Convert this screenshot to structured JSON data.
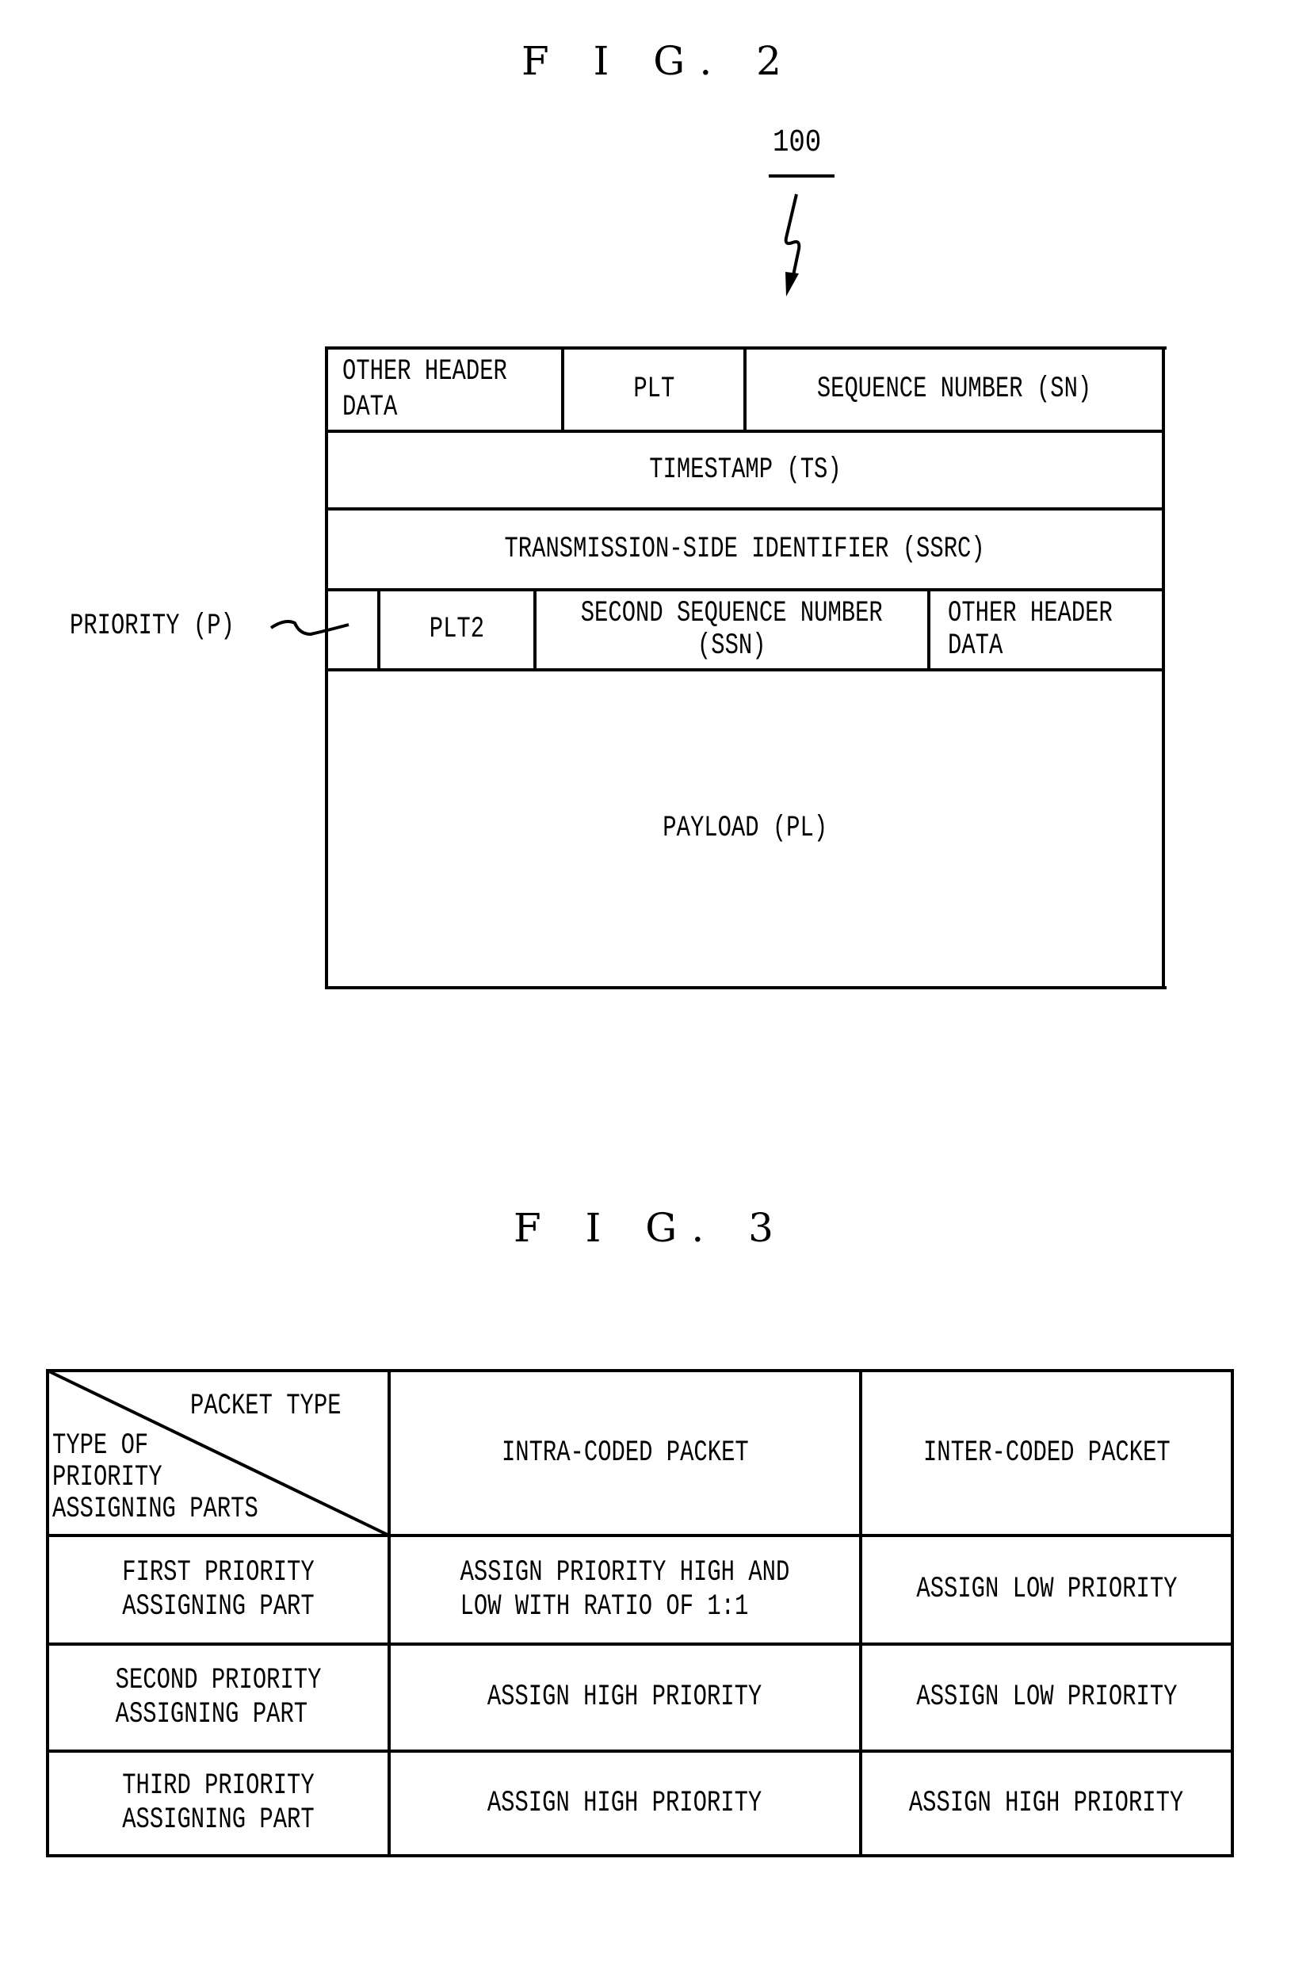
{
  "fig2": {
    "title": "F I G. 2",
    "reference_numeral": "100",
    "priority_label": "PRIORITY (P)",
    "rows": {
      "row1": {
        "other_header": "OTHER HEADER\nDATA",
        "plt": "PLT",
        "sequence_number": "SEQUENCE NUMBER (SN)"
      },
      "timestamp": "TIMESTAMP (TS)",
      "ssrc": "TRANSMISSION-SIDE IDENTIFIER (SSRC)",
      "row4": {
        "priority_field": "",
        "plt2": "PLT2",
        "second_sequence_number": "SECOND SEQUENCE NUMBER\n(SSN)",
        "other_header": "OTHER HEADER\nDATA"
      },
      "payload": "PAYLOAD (PL)"
    }
  },
  "fig3": {
    "title": "F I G. 3",
    "corner_header": {
      "top_right": "PACKET TYPE",
      "bottom_left": "TYPE OF\nPRIORITY\nASSIGNING PARTS"
    },
    "columns": [
      "INTRA-CODED PACKET",
      "INTER-CODED PACKET"
    ],
    "rows": [
      {
        "name": "FIRST PRIORITY\nASSIGNING PART",
        "intra": "ASSIGN PRIORITY HIGH AND\nLOW WITH RATIO OF 1:1",
        "inter": "ASSIGN LOW PRIORITY"
      },
      {
        "name": "SECOND PRIORITY\nASSIGNING PART",
        "intra": "ASSIGN HIGH PRIORITY",
        "inter": "ASSIGN LOW PRIORITY"
      },
      {
        "name": "THIRD PRIORITY\nASSIGNING PART",
        "intra": "ASSIGN HIGH PRIORITY",
        "inter": "ASSIGN HIGH PRIORITY"
      }
    ]
  }
}
